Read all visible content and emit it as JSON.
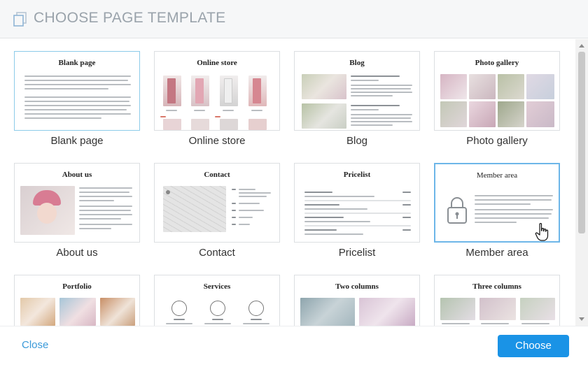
{
  "dialog": {
    "title": "CHOOSE PAGE TEMPLATE",
    "icon": "pages-icon"
  },
  "templates": [
    {
      "label": "Blank page",
      "thumb_title": "Blank page"
    },
    {
      "label": "Online store",
      "thumb_title": "Online store"
    },
    {
      "label": "Blog",
      "thumb_title": "Blog"
    },
    {
      "label": "Photo gallery",
      "thumb_title": "Photo gallery"
    },
    {
      "label": "About us",
      "thumb_title": "About us"
    },
    {
      "label": "Contact",
      "thumb_title": "Contact"
    },
    {
      "label": "Pricelist",
      "thumb_title": "Pricelist"
    },
    {
      "label": "Member area",
      "thumb_title": "Member area"
    },
    {
      "label": "",
      "thumb_title": "Portfolio"
    },
    {
      "label": "",
      "thumb_title": "Services"
    },
    {
      "label": "",
      "thumb_title": "Two columns"
    },
    {
      "label": "",
      "thumb_title": "Three columns"
    }
  ],
  "selected_template": "Blank page",
  "hovered_template": "Member area",
  "footer": {
    "close_label": "Close",
    "choose_label": "Choose"
  },
  "colors": {
    "accent": "#1a93e6",
    "link": "#3a9ad9",
    "title": "#9aa3ab"
  }
}
